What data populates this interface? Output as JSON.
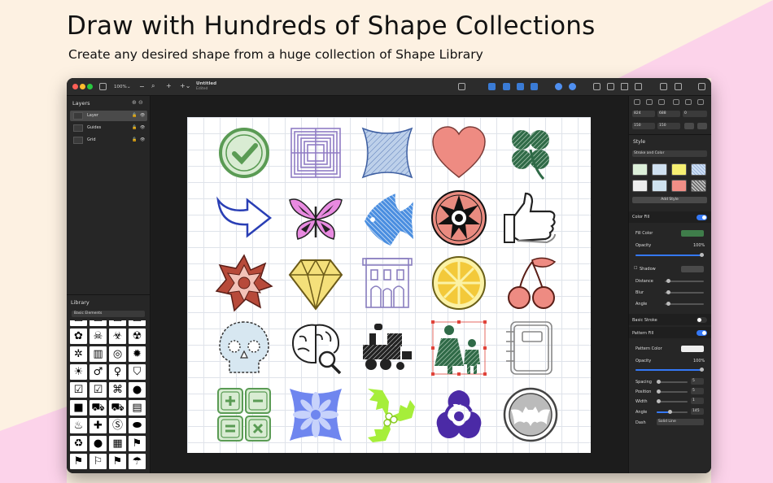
{
  "hero": {
    "headline": "Draw with Hundreds of Shape Collections",
    "subhead": "Create any desired shape from a huge collection of Shape Library"
  },
  "colors": {
    "background": "#fdf1e2",
    "pink_band": "#fcd3ea",
    "window_bg": "#1e1e1e",
    "accent": "#3478f6"
  },
  "titlebar": {
    "zoom": "100%",
    "doc_title": "Untitled",
    "doc_status": "Edited"
  },
  "layers": {
    "title": "Layers",
    "items": [
      {
        "name": "Layer"
      },
      {
        "name": "Guides"
      },
      {
        "name": "Grid"
      }
    ]
  },
  "library": {
    "title": "Library",
    "category": "Basic Elements"
  },
  "inspector": {
    "x": "824",
    "y": "688",
    "rotation": "0",
    "w": "150",
    "h": "150",
    "style_title": "Style",
    "style_mode": "Stroke and Color",
    "add_style": "Add Style",
    "color_fill": {
      "title": "Color Fill",
      "fill_color_label": "Fill Color",
      "opacity_label": "Opacity",
      "opacity_value": "100%",
      "opacity": 1.0
    },
    "shadow": {
      "title": "Shadow",
      "distance_label": "Distance",
      "blur_label": "Blur",
      "angle_label": "Angle"
    },
    "basic_stroke": {
      "title": "Basic Stroke"
    },
    "pattern_fill": {
      "title": "Pattern Fill",
      "pattern_color_label": "Pattern Color",
      "opacity_label": "Opacity",
      "opacity_value": "100%",
      "spacing_label": "Spacing",
      "spacing_value": "5",
      "position_label": "Position",
      "position_value": "5",
      "width_label": "Width",
      "width_value": "1",
      "angle_label": "Angle",
      "angle_value": "145",
      "dash_label": "Dash",
      "dash_value": "Solid Line"
    },
    "swatches": [
      "#dcefd9",
      "#cfe0f0",
      "#f6ef72",
      "#cfe0f5",
      "#eeeeee",
      "#cfe2ee",
      "#f08e86",
      "#707070"
    ]
  },
  "shapes": [
    {
      "name": "checkmark-badge-shape"
    },
    {
      "name": "square-maze-shape"
    },
    {
      "name": "curved-square-shape"
    },
    {
      "name": "heart-shape"
    },
    {
      "name": "four-leaf-clover-shape"
    },
    {
      "name": "curved-arrow-shape"
    },
    {
      "name": "butterfly-shape"
    },
    {
      "name": "angelfish-shape"
    },
    {
      "name": "star-mandala-shape"
    },
    {
      "name": "thumbs-up-shape"
    },
    {
      "name": "star-burst-shape"
    },
    {
      "name": "diamond-shape"
    },
    {
      "name": "building-shape"
    },
    {
      "name": "lemon-slice-shape"
    },
    {
      "name": "cherries-shape"
    },
    {
      "name": "skull-shape"
    },
    {
      "name": "brain-search-shape"
    },
    {
      "name": "locomotive-shape"
    },
    {
      "name": "mother-child-shape"
    },
    {
      "name": "notebook-shape"
    },
    {
      "name": "calculator-keys-shape"
    },
    {
      "name": "flower-tile-shape"
    },
    {
      "name": "holly-leaf-shape"
    },
    {
      "name": "biohazard-shape"
    },
    {
      "name": "bat-emblem-shape"
    }
  ]
}
